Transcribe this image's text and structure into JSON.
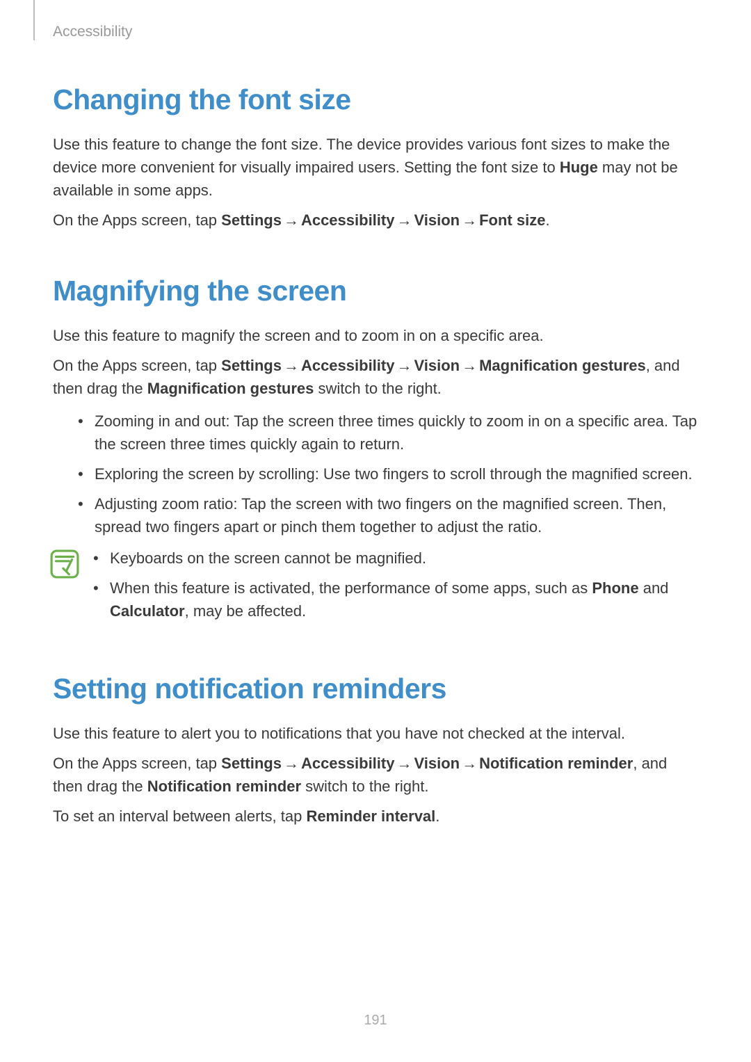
{
  "header": {
    "breadcrumb": "Accessibility"
  },
  "sections": {
    "font_size": {
      "title": "Changing the font size",
      "intro_pre": "Use this feature to change the font size. The device provides various font sizes to make the device more convenient for visually impaired users. Setting the font size to ",
      "intro_bold": "Huge",
      "intro_post": " may not be available in some apps.",
      "path_pre": "On the Apps screen, tap ",
      "path_settings": "Settings",
      "path_accessibility": "Accessibility",
      "path_vision": "Vision",
      "path_fontsize": "Font size",
      "period": "."
    },
    "magnify": {
      "title": "Magnifying the screen",
      "intro": "Use this feature to magnify the screen and to zoom in on a specific area.",
      "path_pre": "On the Apps screen, tap ",
      "path_settings": "Settings",
      "path_accessibility": "Accessibility",
      "path_vision": "Vision",
      "path_mag": "Magnification gestures",
      "path_post1": ", and then drag the ",
      "path_mag_switch": "Magnification gestures",
      "path_post2": " switch to the right.",
      "bullets": {
        "b1": "Zooming in and out: Tap the screen three times quickly to zoom in on a specific area. Tap the screen three times quickly again to return.",
        "b2": "Exploring the screen by scrolling: Use two fingers to scroll through the magnified screen.",
        "b3": "Adjusting zoom ratio: Tap the screen with two fingers on the magnified screen. Then, spread two fingers apart or pinch them together to adjust the ratio."
      },
      "notes": {
        "n1": "Keyboards on the screen cannot be magnified.",
        "n2_pre": "When this feature is activated, the performance of some apps, such as ",
        "n2_phone": "Phone",
        "n2_and": " and ",
        "n2_calc": "Calculator",
        "n2_post": ", may be affected."
      }
    },
    "reminders": {
      "title": "Setting notification reminders",
      "intro": "Use this feature to alert you to notifications that you have not checked at the interval.",
      "path_pre": "On the Apps screen, tap ",
      "path_settings": "Settings",
      "path_accessibility": "Accessibility",
      "path_vision": "Vision",
      "path_notif": "Notification reminder",
      "path_post1": ", and then drag the ",
      "path_notif_switch": "Notification reminder",
      "path_post2": " switch to the right.",
      "interval_pre": "To set an interval between alerts, tap ",
      "interval_bold": "Reminder interval",
      "interval_post": "."
    }
  },
  "arrow": "→",
  "page_number": "191"
}
